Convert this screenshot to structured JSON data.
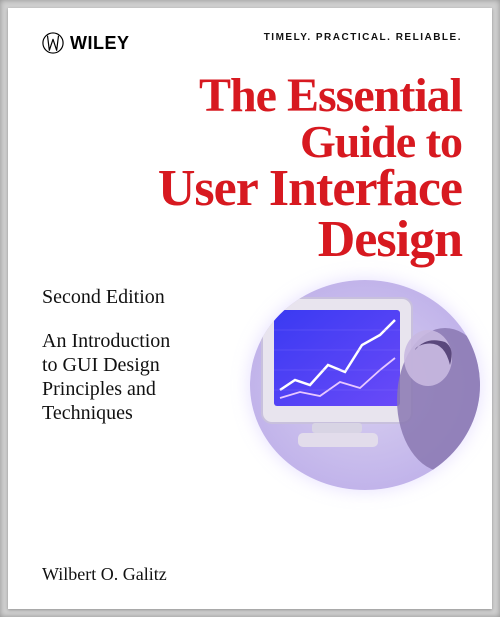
{
  "header": {
    "publisher": "WILEY",
    "tagline": "TIMELY. PRACTICAL. RELIABLE."
  },
  "title": {
    "line1": "The Essential",
    "line2": "Guide to",
    "line3": "User Interface",
    "line4": "Design"
  },
  "edition": "Second Edition",
  "subtitle": {
    "line1": "An Introduction",
    "line2": "to GUI Design",
    "line3": "Principles and",
    "line4": "Techniques"
  },
  "author": "Wilbert O. Galitz"
}
